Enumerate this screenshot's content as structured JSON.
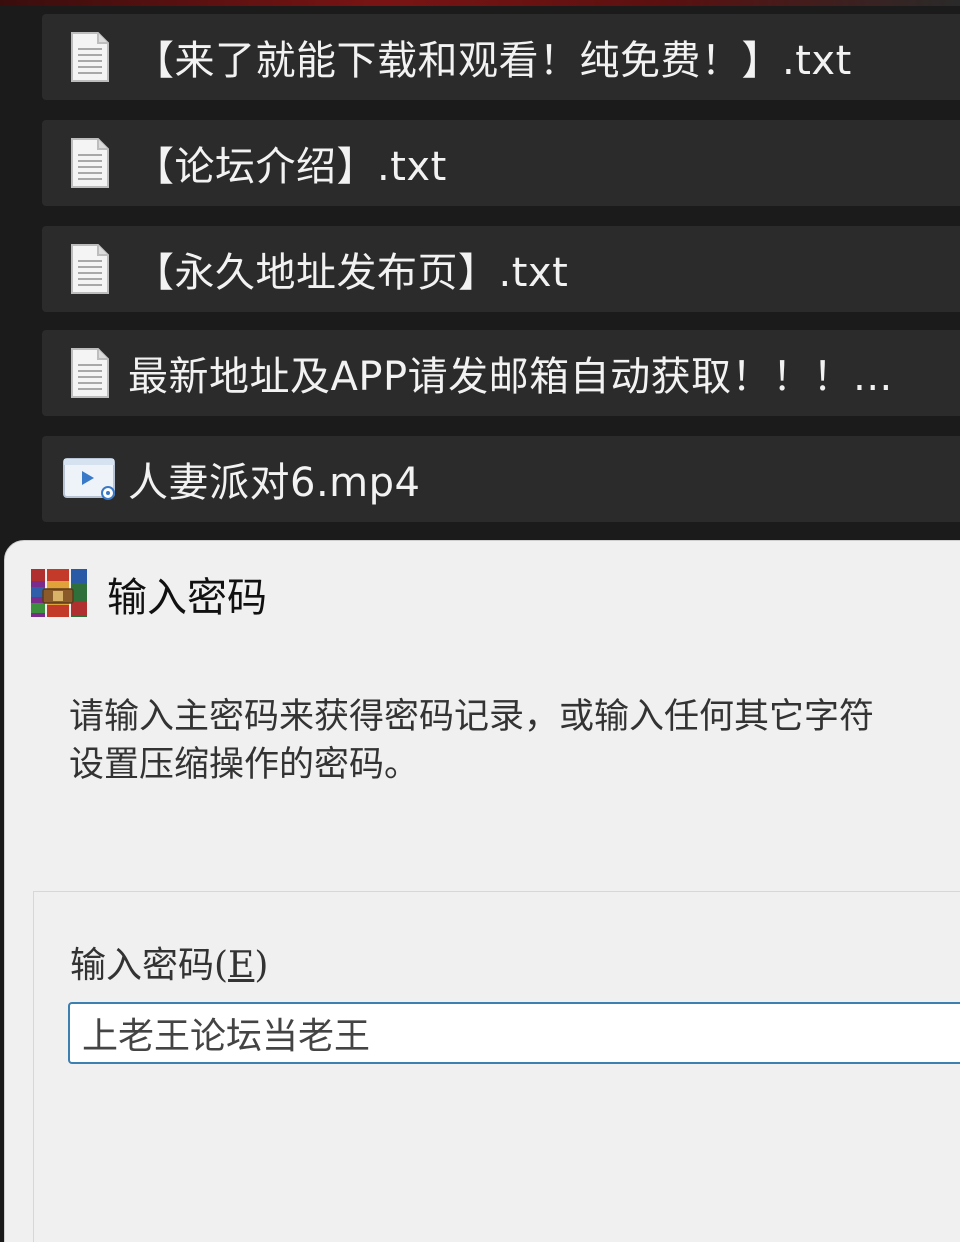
{
  "file_list": {
    "items": [
      {
        "name": "【来了就能下载和观看！纯免费！】.txt",
        "type": "text-file-icon"
      },
      {
        "name": "【论坛介绍】.txt",
        "type": "text-file-icon"
      },
      {
        "name": "【永久地址发布页】.txt",
        "type": "text-file-icon"
      },
      {
        "name": "最新地址及APP请发邮箱自动获取！！！...",
        "type": "text-file-icon"
      },
      {
        "name": "人妻派对6.mp4",
        "type": "video-file-icon"
      }
    ]
  },
  "dialog": {
    "title": "输入密码",
    "app_icon": "winrar-icon",
    "description_line1": "请输入主密码来获得密码记录，或输入任何其它字符",
    "description_line2": "设置压缩操作的密码。",
    "password_label_prefix": "输入密码(",
    "password_label_mnemonic": "E",
    "password_label_suffix": ")",
    "password_value": "上老王论坛当老王"
  },
  "colors": {
    "list_background": "#1b1b1b",
    "row_background": "#2b2b2b",
    "row_text": "#f2f2f2",
    "dialog_background": "#f0f0f0",
    "input_border": "#3c7fb1"
  }
}
